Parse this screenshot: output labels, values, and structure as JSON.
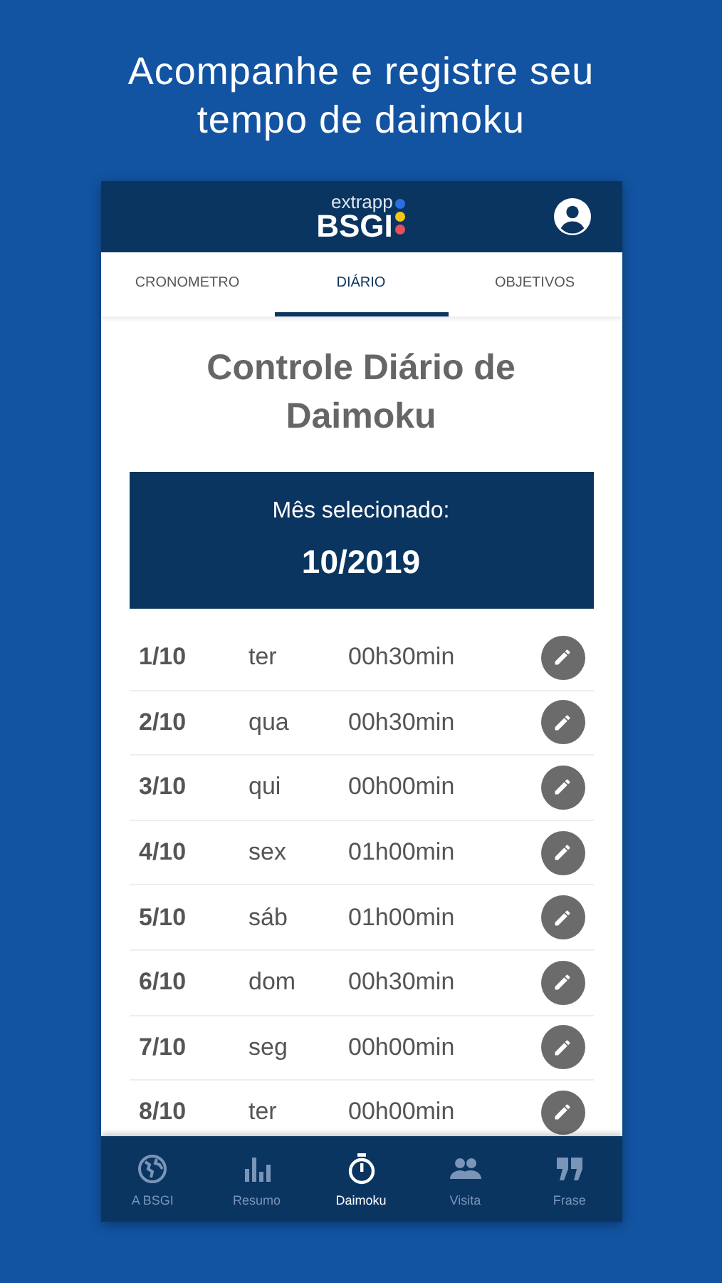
{
  "headline": "Acompanhe e registre seu tempo de daimoku",
  "app_bar": {
    "logo_small": "extrapp",
    "logo_big": "BSGI"
  },
  "tabs": [
    {
      "label": "CRONOMETRO",
      "selected": false
    },
    {
      "label": "DIÁRIO",
      "selected": true
    },
    {
      "label": "OBJETIVOS",
      "selected": false
    }
  ],
  "title": "Controle Diário de Daimoku",
  "month": {
    "label": "Mês selecionado:",
    "value": "10/2019"
  },
  "entries": [
    {
      "date": "1/10",
      "weekday": "ter",
      "time": "00h30min"
    },
    {
      "date": "2/10",
      "weekday": "qua",
      "time": "00h30min"
    },
    {
      "date": "3/10",
      "weekday": "qui",
      "time": "00h00min"
    },
    {
      "date": "4/10",
      "weekday": "sex",
      "time": "01h00min"
    },
    {
      "date": "5/10",
      "weekday": "sáb",
      "time": "01h00min"
    },
    {
      "date": "6/10",
      "weekday": "dom",
      "time": "00h30min"
    },
    {
      "date": "7/10",
      "weekday": "seg",
      "time": "00h00min"
    },
    {
      "date": "8/10",
      "weekday": "ter",
      "time": "00h00min"
    }
  ],
  "bottom_nav": [
    {
      "label": "A BSGI",
      "kind": "globe",
      "selected": false
    },
    {
      "label": "Resumo",
      "kind": "chart",
      "selected": false
    },
    {
      "label": "Daimoku",
      "kind": "timer",
      "selected": true
    },
    {
      "label": "Visita",
      "kind": "people",
      "selected": false
    },
    {
      "label": "Frase",
      "kind": "quote",
      "selected": false
    }
  ]
}
